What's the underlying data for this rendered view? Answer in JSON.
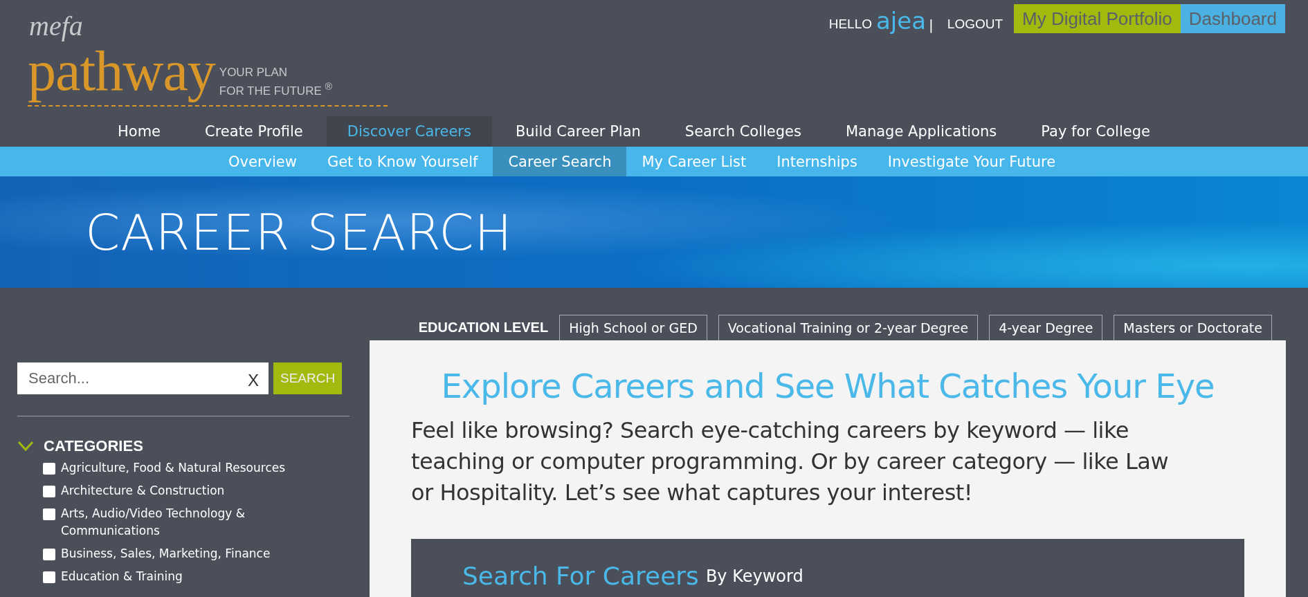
{
  "header": {
    "greeting": "HELLO",
    "username": "ajea",
    "separator": "|",
    "logout": "LOGOUT",
    "buttons": [
      {
        "label": "My Digital Portfolio",
        "kind": "portfolio"
      },
      {
        "label": "Dashboard",
        "kind": "dashboard"
      }
    ]
  },
  "logo": {
    "brand_small": "mefa",
    "brand": "pathway",
    "tagline_1": "YOUR PLAN",
    "tagline_2": "FOR THE FUTURE",
    "mark": "®"
  },
  "nav": [
    {
      "label": "Home",
      "selected": false
    },
    {
      "label": "Create Profile",
      "selected": false
    },
    {
      "label": "Discover Careers",
      "selected": true
    },
    {
      "label": "Build Career Plan",
      "selected": false
    },
    {
      "label": "Search Colleges",
      "selected": false
    },
    {
      "label": "Manage Applications",
      "selected": false
    },
    {
      "label": "Pay for College",
      "selected": false
    }
  ],
  "subnav": [
    {
      "label": "Overview",
      "selected": false
    },
    {
      "label": "Get to Know Yourself",
      "selected": false
    },
    {
      "label": "Career Search",
      "selected": true
    },
    {
      "label": "My Career List",
      "selected": false
    },
    {
      "label": "Internships",
      "selected": false
    },
    {
      "label": "Investigate Your Future",
      "selected": false
    }
  ],
  "banner": {
    "title": "CAREER SEARCH"
  },
  "education_level": {
    "label": "EDUCATION LEVEL",
    "options": [
      {
        "label": "High School or GED",
        "selected": false
      },
      {
        "label": "Vocational Training or 2-year Degree",
        "selected": false
      },
      {
        "label": "4-year Degree",
        "selected": false
      },
      {
        "label": "Masters or Doctorate",
        "selected": false
      }
    ]
  },
  "search": {
    "placeholder": "Search...",
    "clear": "X",
    "button": "SEARCH"
  },
  "categories": {
    "title": "CATEGORIES",
    "expanded": true,
    "items": [
      {
        "label": "Agriculture, Food & Natural Resources",
        "checked": false
      },
      {
        "label": "Architecture & Construction",
        "checked": false
      },
      {
        "label": "Arts, Audio/Video Technology & Communications",
        "checked": false
      },
      {
        "label": "Business, Sales, Marketing, Finance",
        "checked": false
      },
      {
        "label": "Education & Training",
        "checked": false
      }
    ]
  },
  "intro": {
    "heading": "Explore Careers and See What Catches Your Eye",
    "body": "Feel like browsing? Search eye-catching careers by keyword — like teaching or computer programming. Or by career category — like Law or Hospitality. Let’s see what captures your interest!"
  },
  "keyword_search": {
    "title": "Search For Careers",
    "subtitle": "By Keyword"
  }
}
